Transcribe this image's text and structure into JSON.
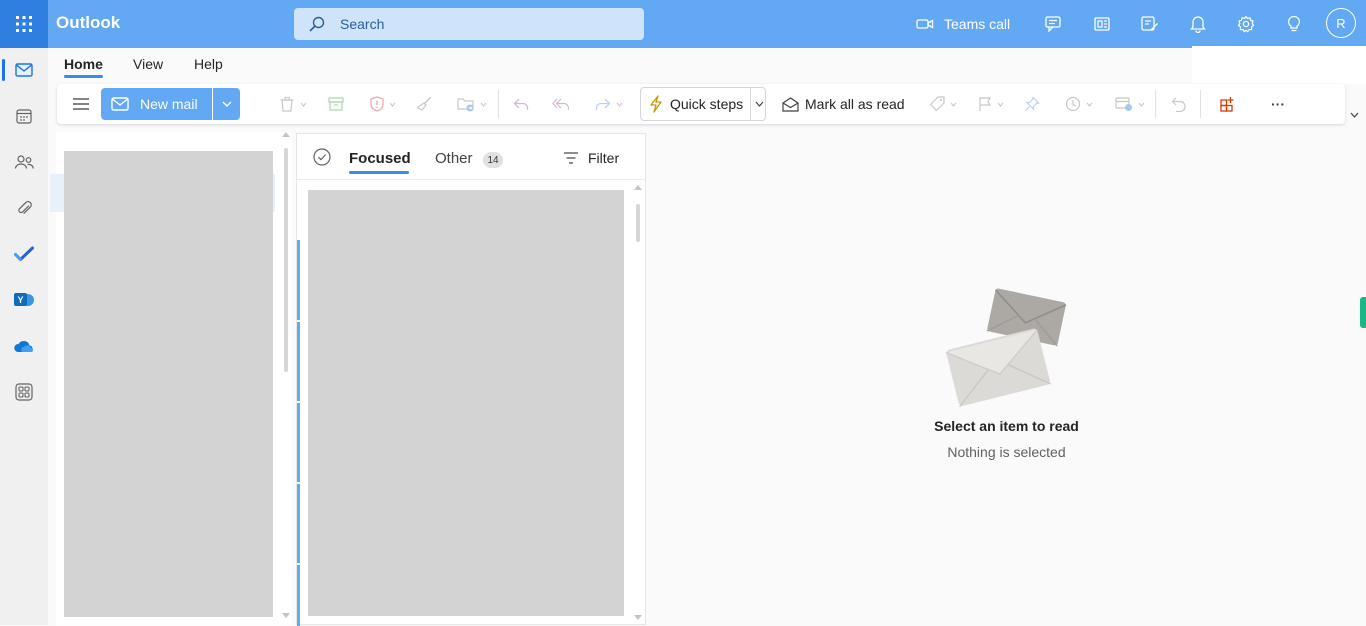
{
  "app": {
    "title": "Outlook"
  },
  "search": {
    "placeholder": "Search"
  },
  "header": {
    "teams_call": "Teams call",
    "avatar_initial": "R"
  },
  "ribbon": {
    "tabs": [
      {
        "label": "Home",
        "active": true
      },
      {
        "label": "View"
      },
      {
        "label": "Help"
      }
    ]
  },
  "toolbar": {
    "new_mail": "New mail",
    "quick_steps": "Quick steps",
    "mark_all_read": "Mark all as read",
    "more": "···"
  },
  "mail_list": {
    "focused_tab": "Focused",
    "other_tab": "Other",
    "other_count": "14",
    "filter": "Filter"
  },
  "reading_pane": {
    "title": "Select an item to read",
    "subtitle": "Nothing is selected"
  },
  "colors": {
    "header_bg": "#62a8f2",
    "waffle_bg": "#2f7fe0",
    "accent": "#3b8ce6",
    "skeleton": "#d3d3d3"
  }
}
